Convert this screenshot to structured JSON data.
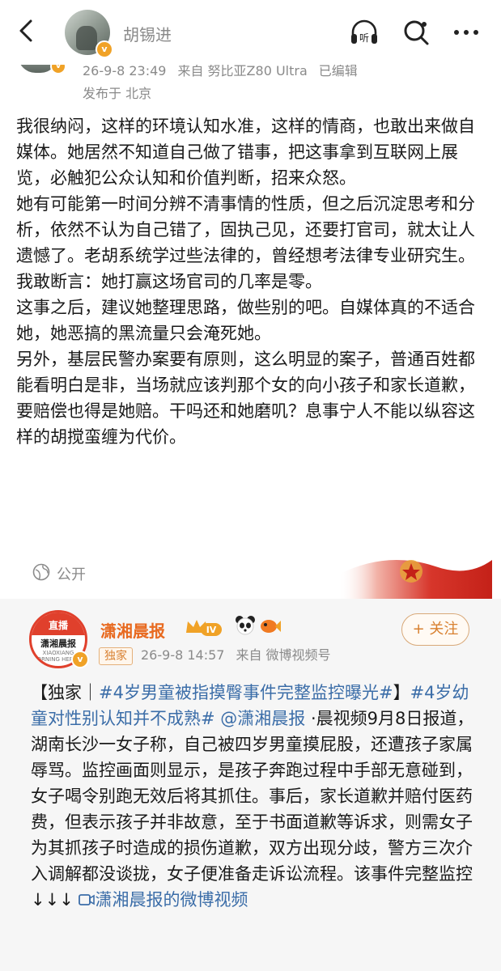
{
  "header": {
    "author_name": "胡锡进",
    "listen_label": "听"
  },
  "post": {
    "time": "26-9-8 23:49",
    "source": "来自 努比亚Z80 Ultra",
    "edited": "已编辑",
    "location": "发布于 北京",
    "paragraphs": [
      "我很纳闷，这样的环境认知水准，这样的情商，也敢出来做自媒体。她居然不知道自己做了错事，把这事拿到互联网上展览，必触犯公众认知和价值判断，招来众怒。",
      "她有可能第一时间分辨不清事情的性质，但之后沉淀思考和分析，依然不认为自己错了，固执己见，还要打官司，就太让人遗憾了。老胡系统学过些法律的，曾经想考法律专业研究生。我敢断言：她打赢这场官司的几率是零。",
      "这事之后，建议她整理思路，做些别的吧。自媒体真的不适合她，她恶搞的黑流量只会淹死她。",
      "另外，基层民警办案要有原则，这么明显的案子，普通百姓都能看明白是非，当场就应该判那个女的向小孩子和家长道歉，要赔偿也得是她赔。干吗还和她磨叽？息事宁人不能以纵容这样的胡搅蛮缠为代价。"
    ],
    "visibility": "公开"
  },
  "repost": {
    "avatar_top": "直播",
    "avatar_mid": "潇湘晨报",
    "avatar_bot": "XIAOXIANG MORNING HERALD",
    "name": "潇湘晨报",
    "level": "IV",
    "follow_label": "+ 关注",
    "tag": "独家",
    "time": "26-9-8 14:57",
    "source": "来自 微博视频号",
    "text_prefix": "【独家｜",
    "hashtag1": "#4岁男童被指摸臀事件完整监控曝光#",
    "text_bracket": "】",
    "hashtag2": "#4岁幼童对性别认知并不成熟#",
    "mention": "@潇湘晨报",
    "text_body": "·晨视频9月8日报道，湖南长沙一女子称，自己被四岁男童摸屁股，还遭孩子家属辱骂。监控画面则显示，是孩子奔跑过程中手部无意碰到，女子喝令别跑无效后将其抓住。事后，家长道歉并赔付医药费，但表示孩子并非故意，至于书面道歉等诉求，则需女子为其抓孩子时造成的损伤道歉，双方出现分歧，警方三次介入调解都没谈拢，女子便准备走诉讼流程。该事件完整监控↓↓↓",
    "video_link": "潇湘晨报的微博视频"
  },
  "colors": {
    "link": "#3b6da8",
    "accent_orange": "#e86a20",
    "meta_gray": "#8a8a8a"
  }
}
